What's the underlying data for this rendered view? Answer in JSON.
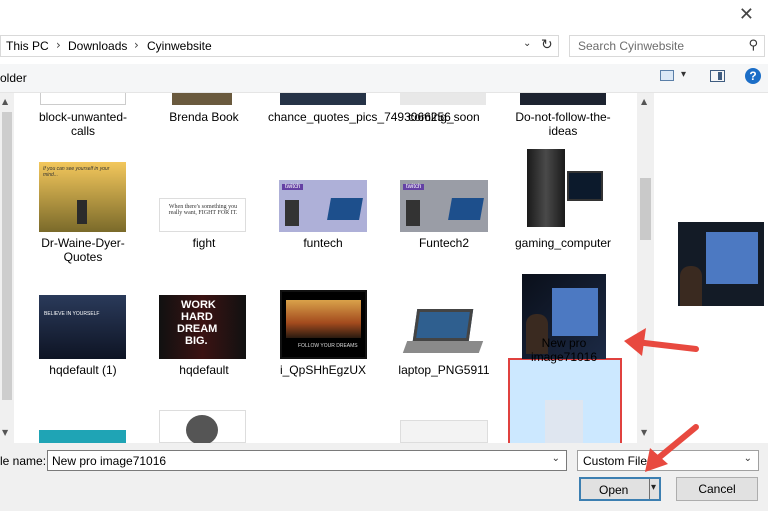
{
  "window": {
    "close_glyph": "✕"
  },
  "address": {
    "crumbs": [
      "This PC",
      "Downloads",
      "Cyinwebsite"
    ],
    "separator": "›",
    "dropdown_glyph": "⌄",
    "refresh_glyph": "↻"
  },
  "search": {
    "placeholder": "Search Cyinwebsite",
    "icon": "search-icon",
    "glyph": "⚲"
  },
  "toolbar": {
    "new_folder_label": "older",
    "view_dropdown_glyph": "▾",
    "help_label": "?"
  },
  "files": [
    {
      "name": "block-unwanted-calls"
    },
    {
      "name": "Brenda Book"
    },
    {
      "name": "chance_quotes_pics_7493066256"
    },
    {
      "name": "coming_soon"
    },
    {
      "name": "Do-not-follow-the-ideas"
    },
    {
      "name": "Dr-Waine-Dyer-Quotes"
    },
    {
      "name": "fight"
    },
    {
      "name": "funtech"
    },
    {
      "name": "Funtech2"
    },
    {
      "name": "gaming_computer"
    },
    {
      "name": "hqdefault (1)"
    },
    {
      "name": "hqdefault"
    },
    {
      "name": "i_QpSHhEgzUX"
    },
    {
      "name": "laptop_PNG5911"
    },
    {
      "name": "New pro image71016",
      "selected": true
    }
  ],
  "thumb_text": {
    "dyer": "If you can see yourself in your mind...",
    "fight": "When there's something you really want, FIGHT FOR IT.",
    "twitch": "twitch",
    "work1": "WORK",
    "work2": "HARD",
    "work3": "DREAM",
    "work4": "BIG.",
    "believe": "BELIEVE IN YOURSELF",
    "follow": "FOLLOW YOUR DREAMS"
  },
  "filename": {
    "label": "le name:",
    "value": "New pro image71016",
    "dropdown_glyph": "⌄"
  },
  "filter": {
    "value": "Custom Files",
    "dropdown_glyph": "⌄"
  },
  "buttons": {
    "open": "Open",
    "open_split_glyph": "▾",
    "cancel": "Cancel"
  },
  "scroll": {
    "up": "▲",
    "down": "▼"
  },
  "colors": {
    "selection_fill": "#cce8ff",
    "selection_border": "#e0413f",
    "arrow": "#e8493f",
    "open_border": "#3c7fb1"
  }
}
